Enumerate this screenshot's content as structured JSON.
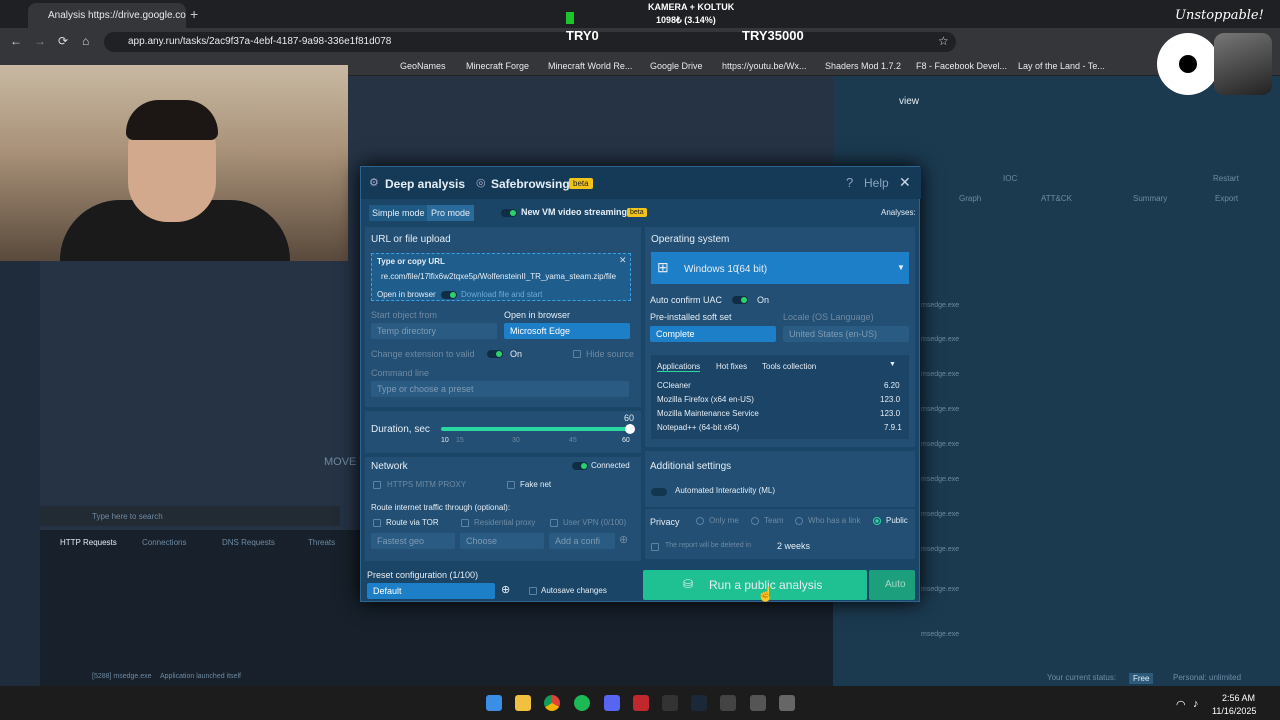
{
  "browser": {
    "tab_title": "Analysis https://drive.google.co",
    "url": "app.any.run/tasks/2ac9f37a-4ebf-4187-9a98-336e1f81d078",
    "bookmarks": [
      "GeoNames",
      "Minecraft Forge",
      "Minecraft World Re...",
      "Google Drive",
      "https://youtu.be/Wx...",
      "Shaders Mod 1.7.2",
      "F8 - Facebook Devel...",
      "Lay of the Land - Te..."
    ]
  },
  "overlay": {
    "line1": "KAMERA + KOLTUK",
    "line2": "1098₺ (3.14%)",
    "left": "TRY0",
    "right": "TRY35000",
    "signature": "Unstoppable!"
  },
  "dialog": {
    "deep_analysis": "Deep analysis",
    "safebrowsing": "Safebrowsing",
    "beta": "beta",
    "help": "Help",
    "simple_mode": "Simple mode",
    "pro_mode": "Pro mode",
    "video_streaming": "New VM video streaming",
    "analyses": "Analyses:",
    "url_upload": {
      "title": "URL or file upload",
      "type_label": "Type or copy URL",
      "value": "re.com/file/17lfix6w2tqxe5p/WolfensteinII_TR_yama_steam.zip/file",
      "open_in_browser": "Open in browser",
      "download_start": "Download file and start"
    },
    "start_object_from": "Start object from",
    "start_object_value": "Temp directory",
    "open_in_browser_label": "Open in browser",
    "browser_value": "Microsoft Edge",
    "change_ext": "Change extension to valid",
    "on": "On",
    "hide_source": "Hide source",
    "command_line": "Command line",
    "command_placeholder": "Type or choose a preset",
    "duration": {
      "label": "Duration, sec",
      "value": "60",
      "ticks": [
        "10",
        "15",
        "30",
        "45",
        "60"
      ],
      "fraction": 1.0
    },
    "network": {
      "title": "Network",
      "connected": "Connected",
      "mitm": "HTTPS MITM PROXY",
      "fake_net": "Fake net",
      "route_title": "Route internet traffic through (optional):",
      "tor": "Route via TOR",
      "residential": "Residential proxy",
      "vpn": "User VPN (0/100)",
      "fastest_geo": "Fastest geo",
      "choose": "Choose",
      "add_config": "Add a confi"
    },
    "os": {
      "title": "Operating system",
      "name": "Windows 10",
      "bits": "(64 bit)",
      "uac": "Auto confirm UAC",
      "soft_set_label": "Pre-installed soft set",
      "soft_set_value": "Complete",
      "locale_label": "Locale (OS Language)",
      "locale_value": "United States (en-US)",
      "tabs": [
        "Applications",
        "Hot fixes",
        "Tools collection"
      ],
      "apps": [
        {
          "name": "CCleaner",
          "ver": "6.20"
        },
        {
          "name": "Mozilla Firefox (x64 en-US)",
          "ver": "123.0"
        },
        {
          "name": "Mozilla Maintenance Service",
          "ver": "123.0"
        },
        {
          "name": "Notepad++ (64-bit x64)",
          "ver": "7.9.1"
        }
      ]
    },
    "additional": {
      "title": "Additional settings",
      "interactivity": "Automated Interactivity (ML)"
    },
    "privacy": {
      "title": "Privacy",
      "options": [
        "Only me",
        "Team",
        "Who has a link",
        "Public"
      ],
      "period": "2 weeks",
      "delete_note": "The report will be deleted in"
    },
    "preset": {
      "label": "Preset configuration (1/100)",
      "value": "Default",
      "autosave": "Autosave changes"
    },
    "run_button": "Run a public analysis",
    "auto": "Auto"
  },
  "background": {
    "right_header": "view",
    "tabs": [
      "IOC",
      "Graph",
      "ATT&CK",
      "Summary",
      "Export",
      "Restart"
    ],
    "processes": [
      "msedge.exe",
      "msedge.exe",
      "msedge.exe",
      "msedge.exe",
      "msedge.exe",
      "msedge.exe",
      "msedge.exe",
      "msedge.exe",
      "msedge.exe",
      "msedge.exe"
    ],
    "status": "Application launched itself",
    "status_proc": "[5288] msedge.exe",
    "free": "Free",
    "unlimited": "Personal: unlimited",
    "current_status": "Your current status:",
    "http_requests": "HTTP Requests",
    "connections": "Connections",
    "dns": "DNS Requests",
    "threats": "Threats",
    "move": "MOVE T",
    "search": "Type here to search"
  },
  "taskbar": {
    "time": "2:56 AM",
    "date": "11/16/2025"
  }
}
